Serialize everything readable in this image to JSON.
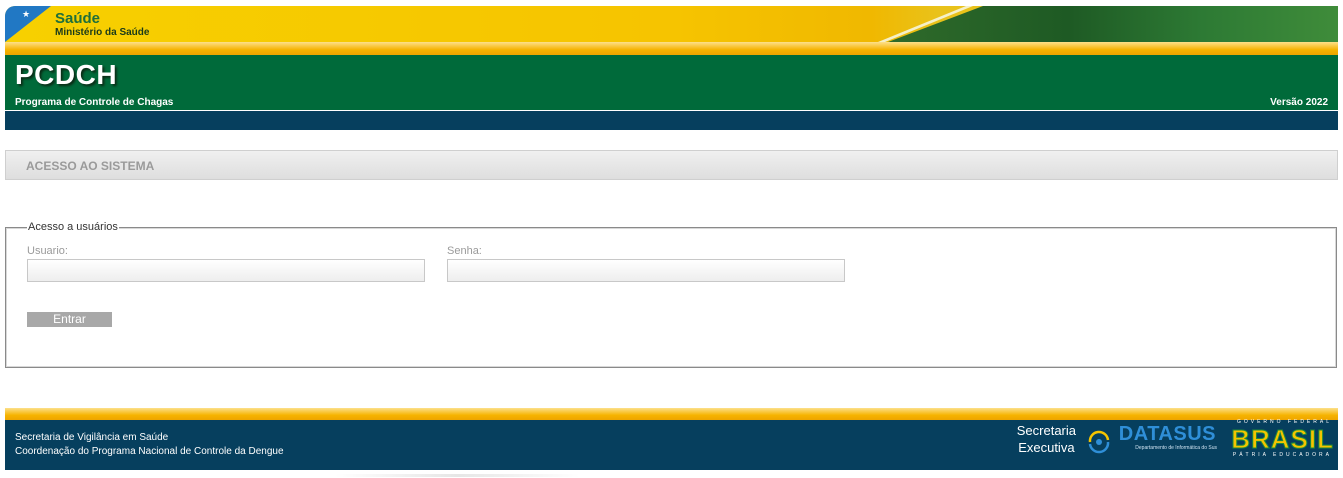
{
  "brand": {
    "title": "Saúde",
    "subtitle": "Ministério da Saúde"
  },
  "header": {
    "title": "PCDCH",
    "subtitle": "Programa de Controle de Chagas",
    "version": "Versão 2022"
  },
  "section": {
    "title": "ACESSO AO SISTEMA"
  },
  "login": {
    "legend": "Acesso a usuários",
    "user_label": "Usuario:",
    "user_value": "",
    "password_label": "Senha:",
    "password_value": "",
    "submit_label": "Entrar"
  },
  "footer": {
    "line1": "Secretaria de Vigilância em Saúde",
    "line2": "Coordenação do Programa Nacional de Controle da Dengue",
    "secretaria_line1": "Secretaria",
    "secretaria_line2": "Executiva",
    "datasus_name": "DATASUS",
    "datasus_sub": "Departamento de Informática do Sus",
    "gov_top": "GOVERNO FEDERAL",
    "gov_brasil": "BRASIL",
    "gov_bottom": "PÁTRIA EDUCADORA"
  },
  "colors": {
    "header_green": "#006a3a",
    "header_blue": "#063f5e",
    "gold": "#f6b300",
    "section_bg": "#e5e5e5",
    "button_gray": "#a8a8a8"
  },
  "icons": [
    "star-icon",
    "datasus-swirl-icon"
  ]
}
